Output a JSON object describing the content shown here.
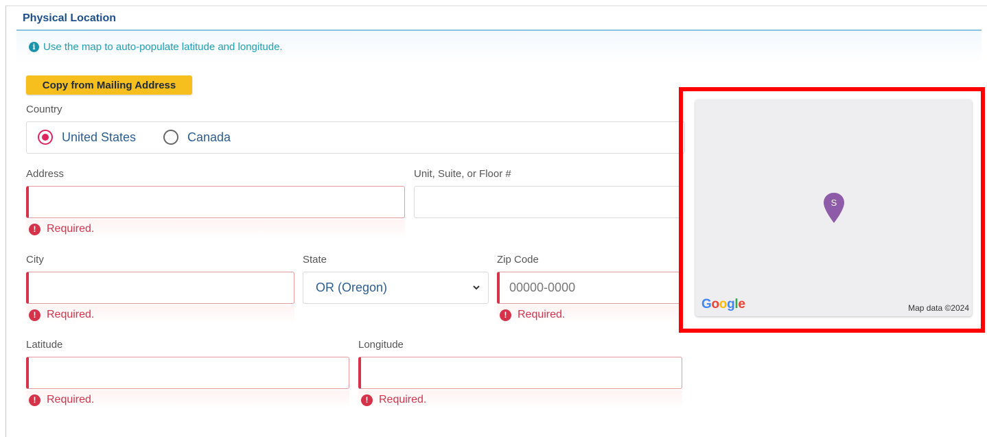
{
  "section": {
    "title": "Physical Location",
    "info": "Use the map to auto-populate latitude and longitude."
  },
  "copy_button": "Copy from Mailing Address",
  "country": {
    "label": "Country",
    "options": [
      "United States",
      "Canada"
    ],
    "selected": "United States"
  },
  "address": {
    "label": "Address",
    "value": "",
    "error": "Required."
  },
  "unit": {
    "label": "Unit, Suite, or Floor #",
    "value": ""
  },
  "city": {
    "label": "City",
    "value": "",
    "error": "Required."
  },
  "state": {
    "label": "State",
    "value": "OR (Oregon)"
  },
  "zip": {
    "label": "Zip Code",
    "placeholder": "00000-0000",
    "error": "Required."
  },
  "latitude": {
    "label": "Latitude",
    "value": "",
    "error": "Required."
  },
  "longitude": {
    "label": "Longitude",
    "value": "",
    "error": "Required."
  },
  "map": {
    "pin_letter": "S",
    "logo": "Google",
    "attribution": "Map data ©2024"
  },
  "colors": {
    "accent": "#e0245e",
    "error": "#d6324a",
    "button": "#f6bf1d",
    "title": "#1d4f8a",
    "info": "#1e9fb3",
    "highlight": "#ff0000",
    "pin": "#8e5ba8"
  }
}
